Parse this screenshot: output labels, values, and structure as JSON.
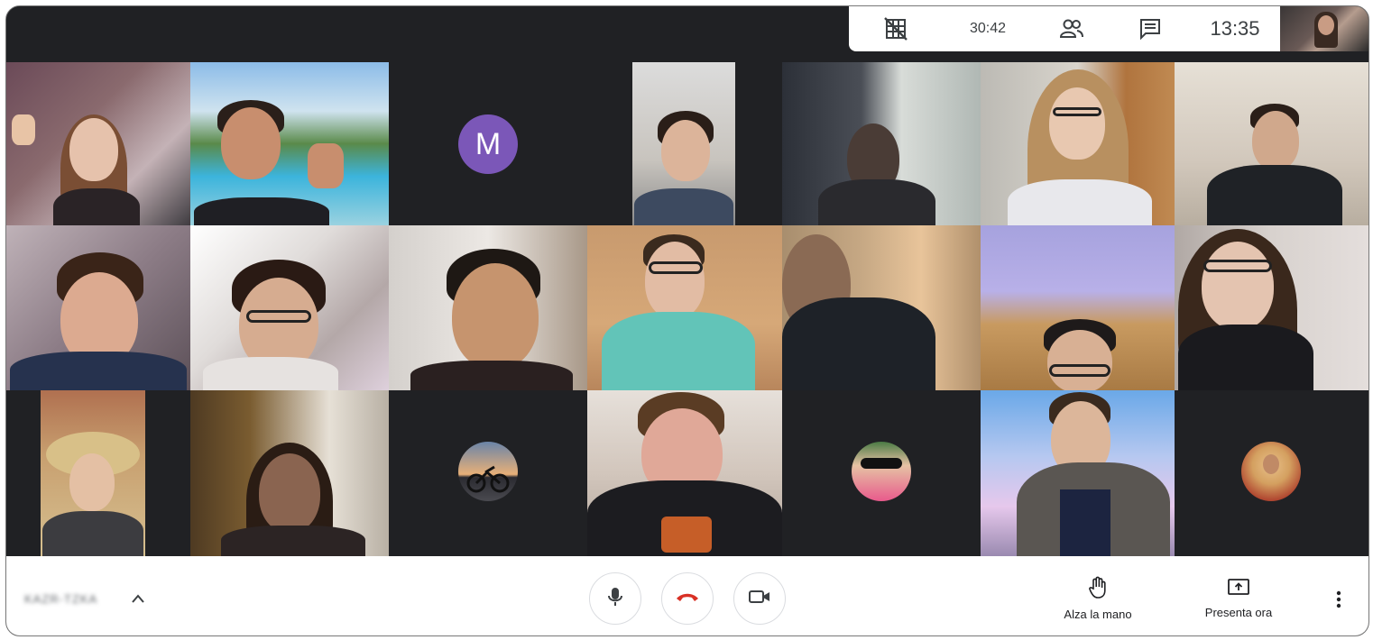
{
  "top_info": {
    "timer": "30:42",
    "clock": "13:35",
    "grid_icon": "grid-off-icon",
    "people_icon": "people-icon",
    "chat_icon": "chat-icon"
  },
  "tiles": {
    "avatar_letter": "M"
  },
  "bottom_bar": {
    "meeting_name": "KAZR-TZKA",
    "raise_hand_label": "Alza la mano",
    "present_label": "Presenta ora"
  },
  "colors": {
    "end_call_red": "#d93025",
    "avatar_purple": "#7b57b8",
    "dark_bg": "#202124"
  }
}
